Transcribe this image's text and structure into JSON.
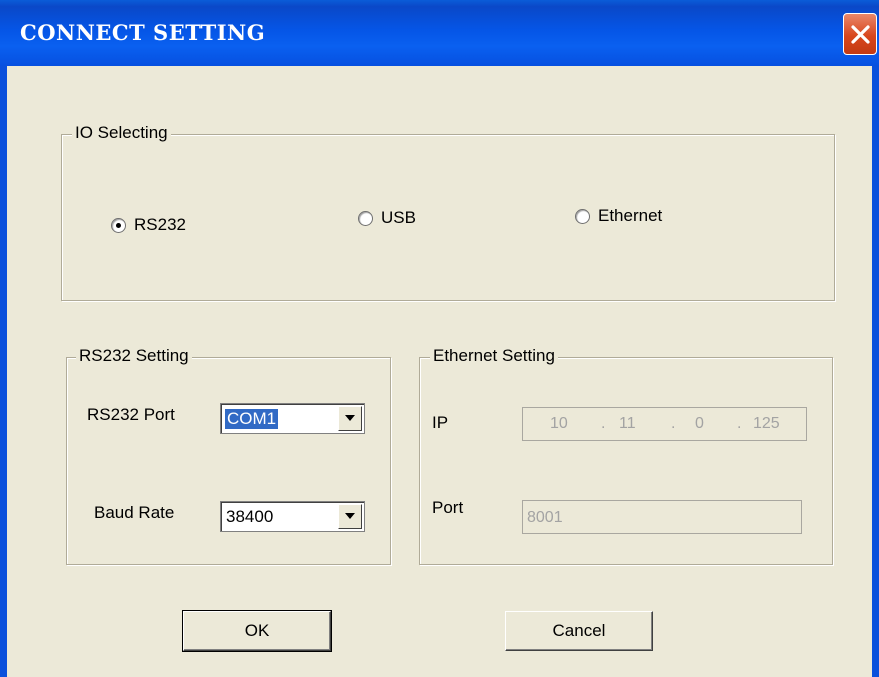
{
  "window": {
    "title": "CONNECT SETTING"
  },
  "io_group": {
    "legend": "IO Selecting",
    "options": [
      {
        "label": "RS232",
        "selected": true
      },
      {
        "label": "USB",
        "selected": false
      },
      {
        "label": "Ethernet",
        "selected": false
      }
    ]
  },
  "rs232_group": {
    "legend": "RS232 Setting",
    "port_label": "RS232 Port",
    "port_value": "COM1",
    "baud_label": "Baud Rate",
    "baud_value": "38400"
  },
  "ethernet_group": {
    "legend": "Ethernet Setting",
    "ip_label": "IP",
    "ip_octets": [
      "10",
      ".",
      "11",
      ".",
      "0",
      ".",
      "125"
    ],
    "port_label": "Port",
    "port_value": "8001"
  },
  "buttons": {
    "ok": "OK",
    "cancel": "Cancel"
  },
  "colors": {
    "titlebar": "#0555e6",
    "face": "#ece9d8",
    "selection": "#316ac5",
    "close": "#d8461d"
  },
  "icons": {
    "close": "close-icon",
    "combo_arrow": "chevron-down-icon"
  }
}
